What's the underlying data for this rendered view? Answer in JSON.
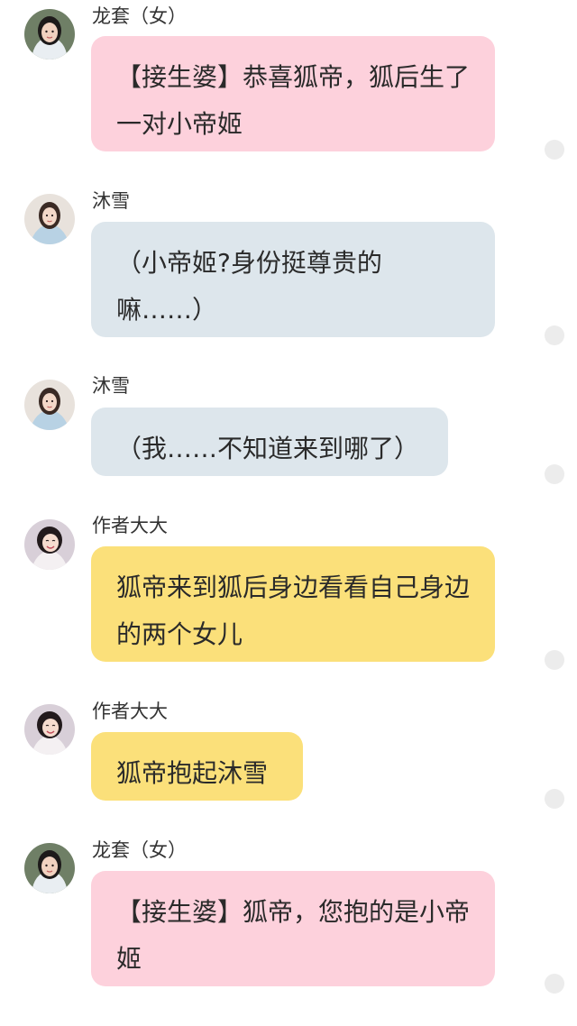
{
  "messages": [
    {
      "sender": "龙套（女）",
      "avatar_icon": "avatar-girl-dark-hair-icon",
      "bubble_color": "pink",
      "text": "【接生婆】恭喜狐帝，狐后生了一对小帝姬"
    },
    {
      "sender": "沐雪",
      "avatar_icon": "avatar-girl-light-dress-icon",
      "bubble_color": "blue",
      "text": "（小帝姬?身份挺尊贵的嘛……）"
    },
    {
      "sender": "沐雪",
      "avatar_icon": "avatar-girl-light-dress-icon",
      "bubble_color": "blue",
      "text": "（我……不知道来到哪了）"
    },
    {
      "sender": "作者大大",
      "avatar_icon": "avatar-girl-smiling-icon",
      "bubble_color": "yellow",
      "text": "狐帝来到狐后身边看看自己身边的两个女儿"
    },
    {
      "sender": "作者大大",
      "avatar_icon": "avatar-girl-smiling-icon",
      "bubble_color": "yellow",
      "text": "狐帝抱起沐雪"
    },
    {
      "sender": "龙套（女）",
      "avatar_icon": "avatar-girl-dark-hair-icon",
      "bubble_color": "pink",
      "text": "【接生婆】狐帝，您抱的是小帝姬"
    }
  ],
  "colors": {
    "pink_bubble": "#fdd1dc",
    "blue_bubble": "#dde6ec",
    "yellow_bubble": "#fbe07a",
    "read_dot": "#ececec"
  }
}
